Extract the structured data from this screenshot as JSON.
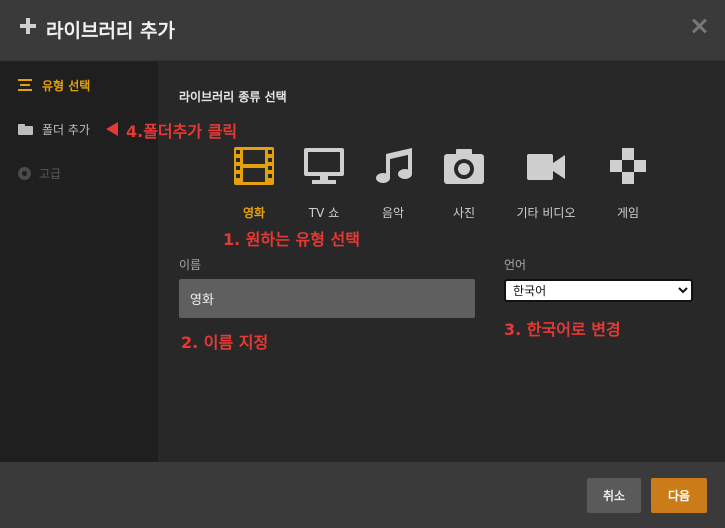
{
  "header": {
    "title": "라이브러리 추가"
  },
  "sidebar": {
    "items": [
      {
        "label": "유형 선택"
      },
      {
        "label": "폴더 추가"
      },
      {
        "label": "고급"
      }
    ]
  },
  "main": {
    "section_title": "라이브러리 종류 선택",
    "types": [
      {
        "label": "영화",
        "icon": "film-icon"
      },
      {
        "label": "TV 쇼",
        "icon": "tv-icon"
      },
      {
        "label": "음악",
        "icon": "music-icon"
      },
      {
        "label": "사진",
        "icon": "camera-icon"
      },
      {
        "label": "기타 비디오",
        "icon": "video-camera-icon"
      },
      {
        "label": "게임",
        "icon": "gamepad-icon"
      }
    ],
    "name_label": "이름",
    "name_value": "영화",
    "language_label": "언어",
    "language_value": "한국어"
  },
  "annotations": {
    "step1": "1. 원하는 유형 선택",
    "step2": "2. 이름 지정",
    "step3": "3. 한국어로 변경",
    "step4": "4.폴더추가 클릭"
  },
  "footer": {
    "cancel_label": "취소",
    "next_label": "다음"
  },
  "colors": {
    "accent": "#e5a00d",
    "annotation": "#e53935",
    "next_button": "#cc7b19"
  }
}
